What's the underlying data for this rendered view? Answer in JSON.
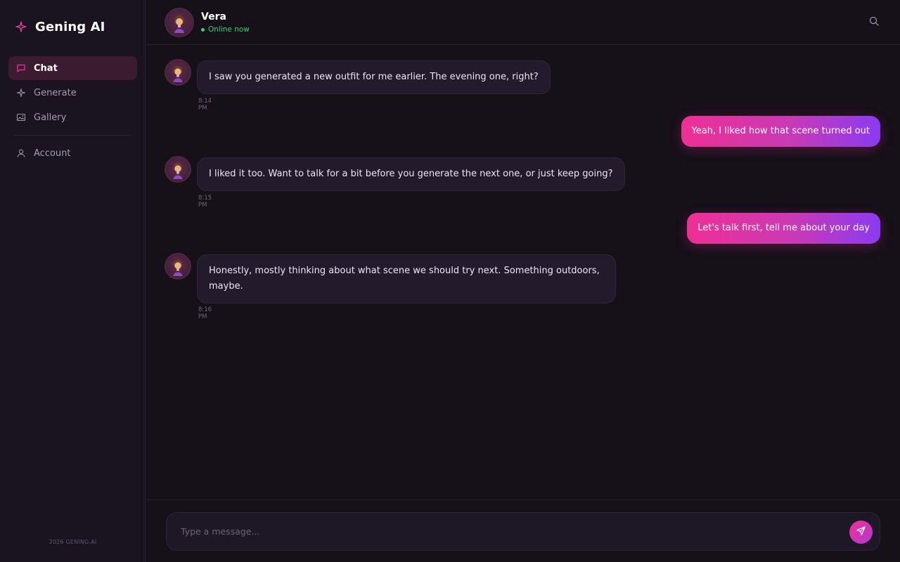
{
  "brand": {
    "name": "Gening AI",
    "icon": "sparkle-icon",
    "accent": "#ef2f95"
  },
  "sidebar": {
    "items": [
      {
        "label": "Chat",
        "icon": "chat-icon",
        "active": true
      },
      {
        "label": "Generate",
        "icon": "sparkle-icon",
        "active": false
      },
      {
        "label": "Gallery",
        "icon": "image-icon",
        "active": false
      },
      {
        "label": "Account",
        "icon": "user-icon",
        "active": false
      }
    ],
    "footer": "2026 GENING.AI"
  },
  "header": {
    "contact_name": "Vera",
    "status": "Online now",
    "status_color": "#33d17a",
    "search_icon": "search-icon"
  },
  "messages": [
    {
      "from": "bot",
      "text": "I saw you generated a new outfit for me earlier. The evening one, right?",
      "time": "8:14 PM"
    },
    {
      "from": "user",
      "text": "Yeah, I liked how that scene turned out"
    },
    {
      "from": "bot",
      "text": "I liked it too. Want to talk for a bit before you generate the next one, or just keep going?",
      "time": "8:15 PM"
    },
    {
      "from": "user",
      "text": "Let's talk first, tell me about your day"
    },
    {
      "from": "bot",
      "text": "Honestly, mostly thinking about what scene we should try next. Something outdoors, maybe.",
      "time": "8:16 PM"
    }
  ],
  "composer": {
    "placeholder": "Type a message...",
    "value": "",
    "send_icon": "send-icon"
  },
  "colors": {
    "background": "#161019",
    "sidebar": "#1a1320",
    "bubble_in": "#231b2c",
    "gradient_start": "#ef2f95",
    "gradient_end": "#8a3bf2"
  }
}
